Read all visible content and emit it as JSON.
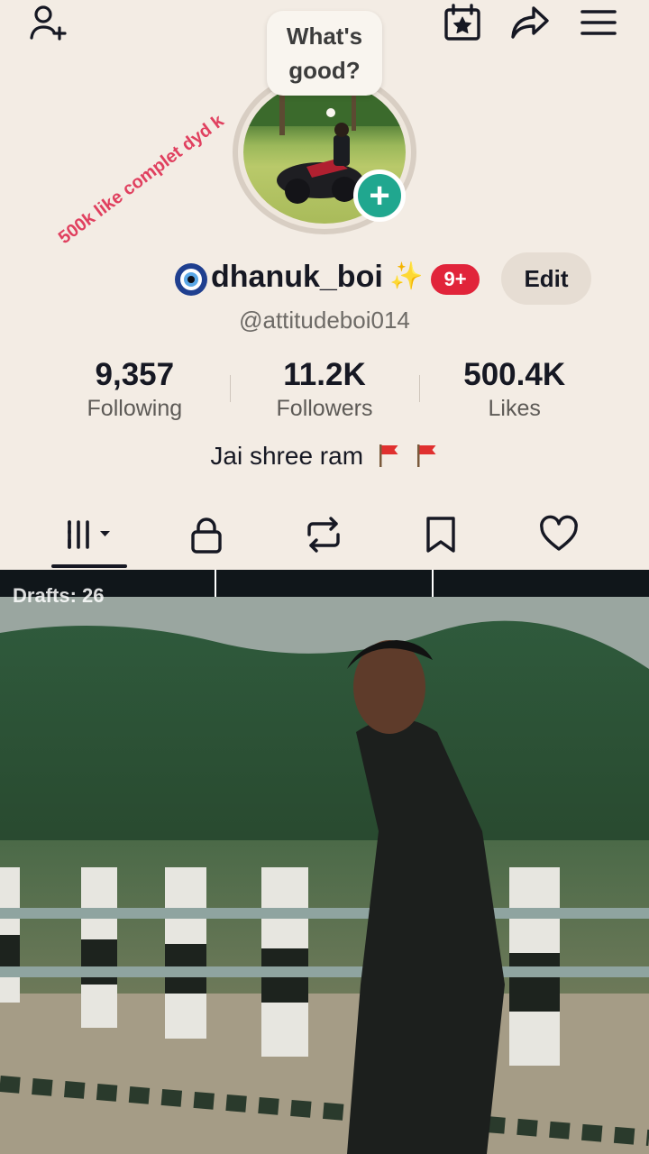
{
  "speech_bubble": {
    "text": "What's\ngood?"
  },
  "promo_text": "500k like complet dyd k",
  "profile": {
    "username": "dhanuk_boi",
    "sparkle": "✨",
    "notification_badge": "9+",
    "edit_label": "Edit",
    "handle": "@attitudeboi014",
    "bio": "Jai shree ram"
  },
  "stats": {
    "following": {
      "value": "9,357",
      "label": "Following"
    },
    "followers": {
      "value": "11.2K",
      "label": "Followers"
    },
    "likes": {
      "value": "500.4K",
      "label": "Likes"
    }
  },
  "grid": {
    "drafts_label": "Drafts: 26"
  },
  "colors": {
    "background": "#f3ece4",
    "accent_teal": "#20a78f",
    "badge_red": "#e1243a",
    "promo_pink": "#e0405f"
  },
  "icons": {
    "top_bar": [
      "add-friend-icon",
      "creator-calendar-icon",
      "share-icon",
      "menu-icon"
    ],
    "tabs": [
      "videos-grid-icon",
      "private-lock-icon",
      "reposts-icon",
      "favorites-bookmark-icon",
      "liked-heart-icon"
    ]
  }
}
